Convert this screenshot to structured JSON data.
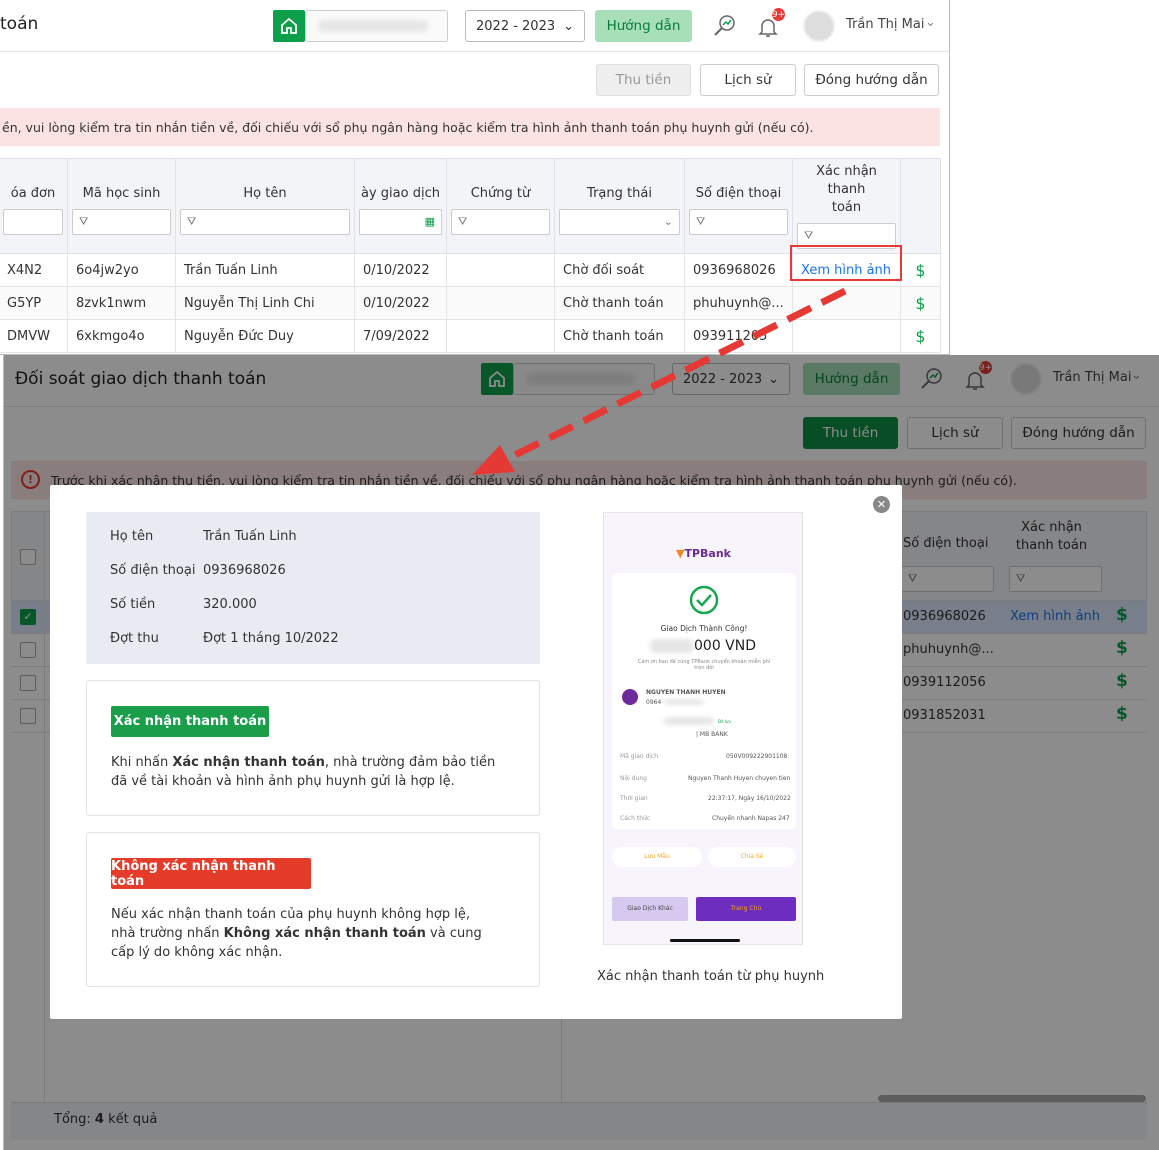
{
  "top": {
    "title": "toán",
    "year": "2022 - 2023",
    "guide_label": "Hướng dẫn",
    "badge": "9+",
    "user": "Trần Thị Mai",
    "buttons": {
      "collect": "Thu tiền",
      "history": "Lịch sử",
      "close_guide": "Đóng hướng dẫn"
    },
    "alert": "ền, vui lòng kiểm tra tin nhắn tiền về, đối chiếu với sổ phụ ngân hàng hoặc kiểm tra hình ảnh thanh toán phụ huynh gửi (nếu có).",
    "columns": [
      "óa đơn",
      "Mã học sinh",
      "Họ tên",
      "ày giao dịch",
      "Chứng từ",
      "Trạng thái",
      "Số điện thoại",
      "Xác nhận thanh toán"
    ],
    "rows": [
      {
        "invoice": "X4N2",
        "code": "6o4jw2yo",
        "name": "Trần Tuấn Linh",
        "date": "0/10/2022",
        "doc": "",
        "status": "Chờ đối soát",
        "phone": "0936968026",
        "confirm": "Xem hình ảnh"
      },
      {
        "invoice": "G5YP",
        "code": "8zvk1nwm",
        "name": "Nguyễn Thị Linh Chi",
        "date": "0/10/2022",
        "doc": "",
        "status": "Chờ thanh toán",
        "phone": "phuhuynh@...",
        "confirm": ""
      },
      {
        "invoice": "DMVW",
        "code": "6xkmgo4o",
        "name": "Nguyễn Đức Duy",
        "date": "7/09/2022",
        "doc": "",
        "status": "Chờ thanh toán",
        "phone": "093911205",
        "confirm": ""
      }
    ]
  },
  "bottom": {
    "title": "Đối soát giao dịch thanh toán",
    "year": "2022 - 2023",
    "guide_label": "Hướng dẫn",
    "badge": "9+",
    "user": "Trần Thị Mai",
    "buttons": {
      "collect": "Thu tiền",
      "history": "Lịch sử",
      "close_guide": "Đóng hướng dẫn"
    },
    "alert": "Trước khi xác nhận thu tiền, vui lòng kiểm tra tin nhắn tiền về, đối chiếu với sổ phụ ngân hàng hoặc kiểm tra hình ảnh thanh toán phụ huynh gửi (nếu có).",
    "columns": {
      "phone": "Số điện thoại",
      "confirm": "Xác nhận thanh toán"
    },
    "rows": [
      {
        "phone": "0936968026",
        "confirm": "Xem hình ảnh",
        "checked": true
      },
      {
        "phone": "phuhuynh@...",
        "confirm": "",
        "checked": false
      },
      {
        "phone": "0939112056",
        "confirm": "",
        "checked": false
      },
      {
        "phone": "0931852031",
        "confirm": "",
        "checked": false
      }
    ],
    "footer": {
      "prefix": "Tổng: ",
      "count": "4",
      "suffix": " kết quả"
    }
  },
  "modal": {
    "info": {
      "name_label": "Họ tên",
      "name": "Trần Tuấn Linh",
      "phone_label": "Số điện thoại",
      "phone": "0936968026",
      "amount_label": "Số tiền",
      "amount": "320.000",
      "period_label": "Đợt thu",
      "period": "Đợt 1 tháng 10/2022"
    },
    "confirm_button": "Xác nhận thanh toán",
    "confirm_desc_1": "Khi nhấn ",
    "confirm_desc_bold": "Xác nhận thanh toán",
    "confirm_desc_2": ", nhà trường đảm bảo tiền đã về tài khoản và hình ảnh phụ huynh gửi là hợp lệ.",
    "reject_button": "Không xác nhận thanh toán",
    "reject_desc_1": "Nếu xác nhận thanh toán của phụ huynh không hợp lệ, nhà trường nhấn ",
    "reject_desc_bold": "Không xác nhận thanh toán",
    "reject_desc_2": " và cung cấp lý do không xác nhận.",
    "image_caption": "Xác nhận thanh toán từ phụ huynh",
    "receipt": {
      "bank": "TPBank",
      "success": "Giao Dịch Thành Công!",
      "amount": "000 VND",
      "thanks": "Cảm ơn bạn đã cùng TPBank chuyển khoản miễn phí trọn đời",
      "sender": "NGUYEN THANH HUYEN",
      "sender_acc": "0964",
      "bank_tag": "| MB BANK",
      "saved": "Đã lưu",
      "tx_label": "Mã giao dịch",
      "tx": "050V009222901108",
      "content_label": "Nội dung",
      "content": "Nguyen Thanh Huyen chuyen tien",
      "time_label": "Thời gian",
      "time": "22:37:17, Ngày 16/10/2022",
      "method_label": "Cách thức",
      "method": "Chuyển nhanh Napas 247",
      "save_btn": "Lưu Mẫu",
      "share_btn": "Chia Sẻ",
      "other_btn": "Giao Dịch Khác",
      "home_btn": "Trang Chủ"
    }
  },
  "colors": {
    "green": "#0e9f4a",
    "red": "#e53935",
    "highlight": "#e53935",
    "link": "#1a73e8"
  }
}
